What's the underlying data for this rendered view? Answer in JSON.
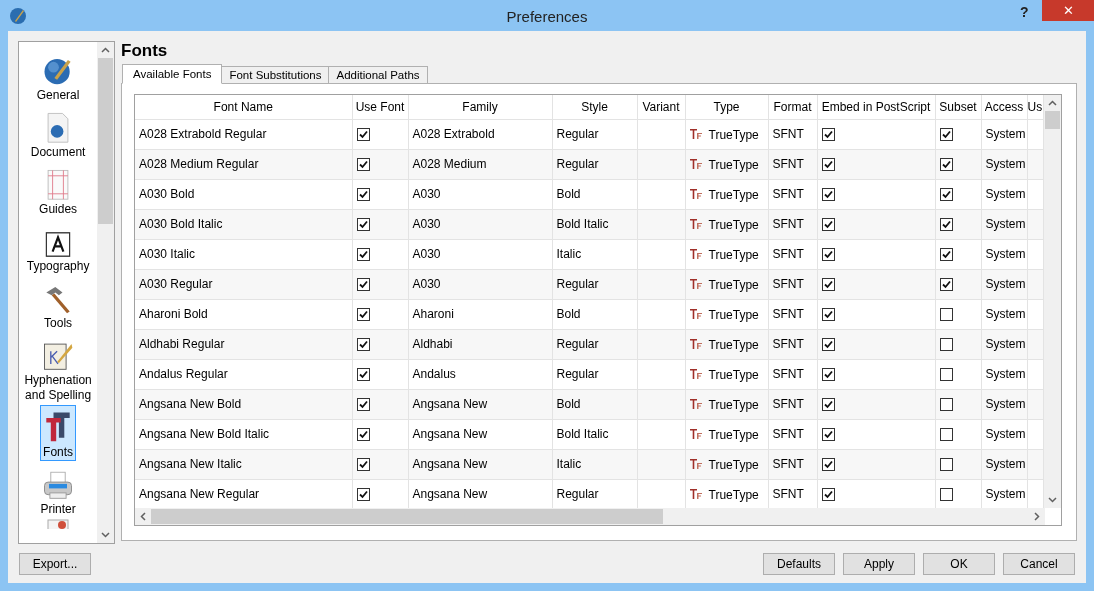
{
  "window": {
    "title": "Preferences",
    "help": "?",
    "close": "✕"
  },
  "sidebar": {
    "items": [
      {
        "label": "General",
        "selected": false
      },
      {
        "label": "Document",
        "selected": false
      },
      {
        "label": "Guides",
        "selected": false
      },
      {
        "label": "Typography",
        "selected": false
      },
      {
        "label": "Tools",
        "selected": false
      },
      {
        "label": "Hyphenation and Spelling",
        "selected": false
      },
      {
        "label": "Fonts",
        "selected": true
      },
      {
        "label": "Printer",
        "selected": false
      }
    ]
  },
  "page_title": "Fonts",
  "tabs": [
    {
      "label": "Available Fonts",
      "selected": true
    },
    {
      "label": "Font Substitutions",
      "selected": false
    },
    {
      "label": "Additional Paths",
      "selected": false
    }
  ],
  "table": {
    "columns": [
      "Font Name",
      "Use Font",
      "Family",
      "Style",
      "Variant",
      "Type",
      "Format",
      "Embed in PostScript",
      "Subset",
      "Access",
      "Us"
    ],
    "rows": [
      {
        "font_name": "A028 Extrabold Regular",
        "use_font": true,
        "family": "A028 Extrabold",
        "style": "Regular",
        "type": "TrueType",
        "format": "SFNT",
        "embed": true,
        "subset": true,
        "access": "System"
      },
      {
        "font_name": "A028 Medium Regular",
        "use_font": true,
        "family": "A028 Medium",
        "style": "Regular",
        "type": "TrueType",
        "format": "SFNT",
        "embed": true,
        "subset": true,
        "access": "System"
      },
      {
        "font_name": "A030 Bold",
        "use_font": true,
        "family": "A030",
        "style": "Bold",
        "type": "TrueType",
        "format": "SFNT",
        "embed": true,
        "subset": true,
        "access": "System"
      },
      {
        "font_name": "A030 Bold Italic",
        "use_font": true,
        "family": "A030",
        "style": "Bold Italic",
        "type": "TrueType",
        "format": "SFNT",
        "embed": true,
        "subset": true,
        "access": "System"
      },
      {
        "font_name": "A030 Italic",
        "use_font": true,
        "family": "A030",
        "style": "Italic",
        "type": "TrueType",
        "format": "SFNT",
        "embed": true,
        "subset": true,
        "access": "System"
      },
      {
        "font_name": "A030 Regular",
        "use_font": true,
        "family": "A030",
        "style": "Regular",
        "type": "TrueType",
        "format": "SFNT",
        "embed": true,
        "subset": true,
        "access": "System"
      },
      {
        "font_name": "Aharoni Bold",
        "use_font": true,
        "family": "Aharoni",
        "style": "Bold",
        "type": "TrueType",
        "format": "SFNT",
        "embed": true,
        "subset": false,
        "access": "System"
      },
      {
        "font_name": "Aldhabi Regular",
        "use_font": true,
        "family": "Aldhabi",
        "style": "Regular",
        "type": "TrueType",
        "format": "SFNT",
        "embed": true,
        "subset": false,
        "access": "System"
      },
      {
        "font_name": "Andalus Regular",
        "use_font": true,
        "family": "Andalus",
        "style": "Regular",
        "type": "TrueType",
        "format": "SFNT",
        "embed": true,
        "subset": false,
        "access": "System"
      },
      {
        "font_name": "Angsana New Bold",
        "use_font": true,
        "family": "Angsana New",
        "style": "Bold",
        "type": "TrueType",
        "format": "SFNT",
        "embed": true,
        "subset": false,
        "access": "System"
      },
      {
        "font_name": "Angsana New Bold Italic",
        "use_font": true,
        "family": "Angsana New",
        "style": "Bold Italic",
        "type": "TrueType",
        "format": "SFNT",
        "embed": true,
        "subset": false,
        "access": "System"
      },
      {
        "font_name": "Angsana New Italic",
        "use_font": true,
        "family": "Angsana New",
        "style": "Italic",
        "type": "TrueType",
        "format": "SFNT",
        "embed": true,
        "subset": false,
        "access": "System"
      },
      {
        "font_name": "Angsana New Regular",
        "use_font": true,
        "family": "Angsana New",
        "style": "Regular",
        "type": "TrueType",
        "format": "SFNT",
        "embed": true,
        "subset": false,
        "access": "System"
      }
    ]
  },
  "buttons_left": [
    "Export..."
  ],
  "buttons_right": [
    "Defaults",
    "Apply",
    "OK",
    "Cancel"
  ]
}
